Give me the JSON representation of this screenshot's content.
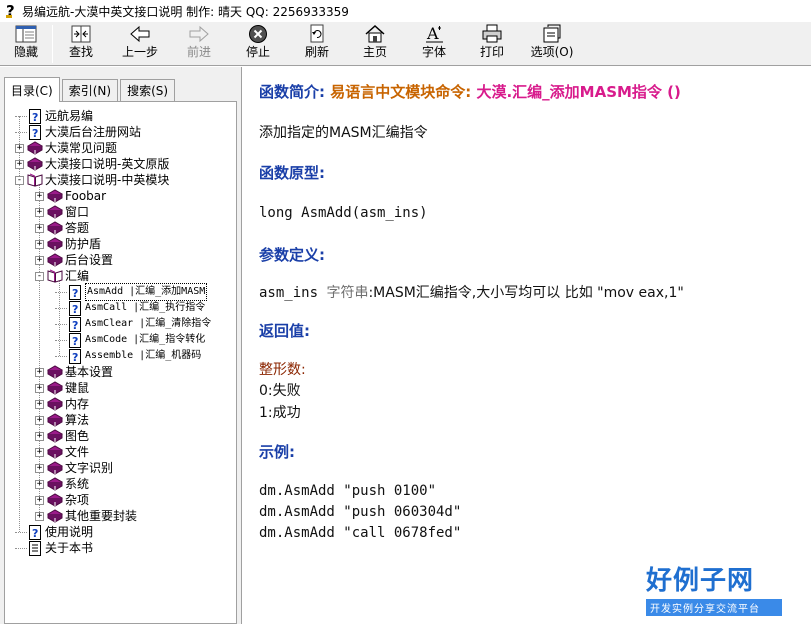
{
  "window": {
    "title": "易编远航-大漠中英文接口说明  制作: 晴天 QQ: 2256933359"
  },
  "toolbar": {
    "buttons": [
      {
        "label": "隐藏",
        "icon": "hide-pane-icon"
      },
      {
        "label": "查找",
        "icon": "locate-icon"
      },
      {
        "label": "上一步",
        "icon": "back-arrow-icon"
      },
      {
        "label": "前进",
        "icon": "forward-arrow-icon"
      },
      {
        "label": "停止",
        "icon": "stop-icon"
      },
      {
        "label": "刷新",
        "icon": "refresh-icon"
      },
      {
        "label": "主页",
        "icon": "home-icon"
      },
      {
        "label": "字体",
        "icon": "font-icon"
      },
      {
        "label": "打印",
        "icon": "print-icon"
      },
      {
        "label": "选项(O)",
        "icon": "options-icon"
      }
    ]
  },
  "tabs": [
    {
      "label": "目录(C)"
    },
    {
      "label": "索引(N)"
    },
    {
      "label": "搜索(S)"
    }
  ],
  "tree": {
    "items": [
      {
        "label": "远航易编",
        "icon": "help-page-icon"
      },
      {
        "label": "大漠后台注册网站",
        "icon": "help-page-icon"
      },
      {
        "label": "大漠常见问题",
        "icon": "book-icon"
      },
      {
        "label": "大漠接口说明-英文原版",
        "icon": "book-icon"
      },
      {
        "label": "大漠接口说明-中英模块",
        "icon": "open-book-icon"
      },
      {
        "label": "Foobar",
        "icon": "book-icon"
      },
      {
        "label": "窗口",
        "icon": "book-icon"
      },
      {
        "label": "答题",
        "icon": "book-icon"
      },
      {
        "label": "防护盾",
        "icon": "book-icon"
      },
      {
        "label": "后台设置",
        "icon": "book-icon"
      },
      {
        "label": "汇编",
        "icon": "open-book-icon"
      },
      {
        "label": "AsmAdd     |汇编_添加MASM",
        "icon": "help-page-icon"
      },
      {
        "label": "AsmCall    |汇编_执行指令",
        "icon": "help-page-icon"
      },
      {
        "label": "AsmClear   |汇编_清除指令",
        "icon": "help-page-icon"
      },
      {
        "label": "AsmCode    |汇编_指令转化",
        "icon": "help-page-icon"
      },
      {
        "label": "Assemble   |汇编_机器码",
        "icon": "help-page-icon"
      },
      {
        "label": "基本设置",
        "icon": "book-icon"
      },
      {
        "label": "键鼠",
        "icon": "book-icon"
      },
      {
        "label": "内存",
        "icon": "book-icon"
      },
      {
        "label": "算法",
        "icon": "book-icon"
      },
      {
        "label": "图色",
        "icon": "book-icon"
      },
      {
        "label": "文件",
        "icon": "book-icon"
      },
      {
        "label": "文字识别",
        "icon": "book-icon"
      },
      {
        "label": "系统",
        "icon": "book-icon"
      },
      {
        "label": "杂项",
        "icon": "book-icon"
      },
      {
        "label": "其他重要封装",
        "icon": "book-icon"
      },
      {
        "label": "使用说明",
        "icon": "help-page-icon"
      },
      {
        "label": "关于本书",
        "icon": "text-page-icon"
      }
    ]
  },
  "content": {
    "intro_heading": "函数简介:",
    "intro_module": "易语言中文模块命令:",
    "intro_name": "大漠.汇编_添加MASM指令 ()",
    "description": "添加指定的MASM汇编指令",
    "prototype_heading": "函数原型:",
    "prototype": "long AsmAdd(asm_ins)",
    "params_heading": "参数定义:",
    "param_name": "asm_ins",
    "param_type": "字符串",
    "param_desc": ":MASM汇编指令,大小写均可以  比如 \"mov eax,1\"",
    "return_heading": "返回值:",
    "return_type": "整形数:",
    "return_0": "0:失败",
    "return_1": "1:成功",
    "example_heading": "示例:",
    "examples": [
      "dm.AsmAdd \"push 0100\"",
      "dm.AsmAdd \"push 060304d\"",
      "dm.AsmAdd \"call 0678fed\""
    ]
  },
  "watermark": {
    "big": "好例子网",
    "small": "开发实例分享交流平台"
  }
}
